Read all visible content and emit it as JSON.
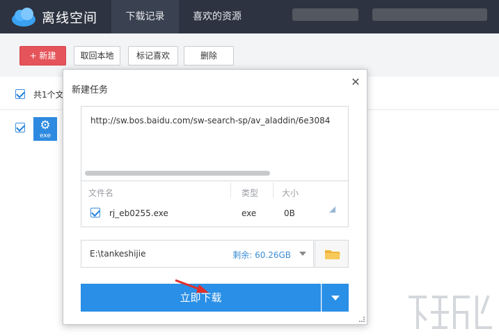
{
  "header": {
    "app_title": "离线空间",
    "tabs": [
      {
        "label": "下载记录",
        "active": true
      },
      {
        "label": "喜欢的资源",
        "active": false
      }
    ]
  },
  "toolbar": {
    "new_label": "+ 新建",
    "fetch_label": "取回本地",
    "mark_label": "标记喜欢",
    "delete_label": "删除"
  },
  "list": {
    "header_text": "共1个文",
    "file_icon_label": "exe"
  },
  "dialog": {
    "title": "新建任务",
    "url": "http://sw.bos.baidu.com/sw-search-sp/av_aladdin/6e3084",
    "columns": {
      "name": "文件名",
      "type": "类型",
      "size": "大小"
    },
    "file": {
      "name": "rj_eb0255.exe",
      "type": "exe",
      "size": "0B"
    },
    "save_path": "E:\\tankeshijie",
    "free_space": "剩余: 60.26GB",
    "download_label": "立即下载"
  },
  "colors": {
    "header_bg": "#2d3340",
    "primary_red": "#e4545a",
    "primary_blue": "#2a8fe6",
    "link_blue": "#3c8dd5"
  },
  "icons": [
    "cloud-logo-icon",
    "plus-icon",
    "gear-icon",
    "close-icon",
    "folder-icon",
    "chevron-down-icon",
    "resize-grip-icon",
    "arrow-annotation-icon"
  ]
}
